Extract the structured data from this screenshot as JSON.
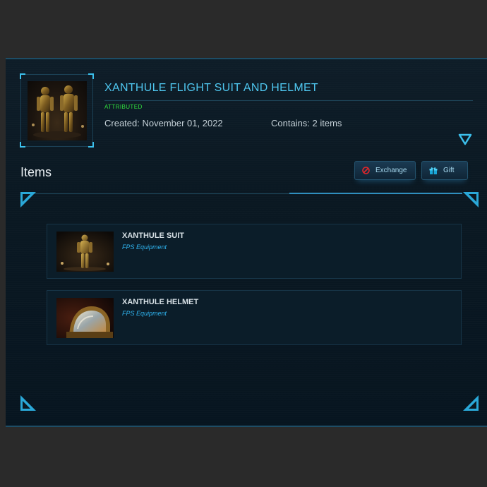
{
  "pledge": {
    "title": "XANTHULE FLIGHT SUIT AND HELMET",
    "status": "ATTRIBUTED",
    "created": "Created: November 01, 2022",
    "contains": "Contains: 2 items",
    "thumbnail": "xanthule-suit-pair-image"
  },
  "items_section": {
    "heading": "Items",
    "buttons": [
      {
        "label": "Exchange",
        "icon": "exchange-icon"
      },
      {
        "label": "Gift",
        "icon": "gift-icon"
      }
    ]
  },
  "items": [
    {
      "name": "XANTHULE SUIT",
      "type": "FPS Equipment",
      "image": "xanthule-suit-image"
    },
    {
      "name": "XANTHULE HELMET",
      "type": "FPS Equipment",
      "image": "xanthule-helmet-image"
    }
  ],
  "colors": {
    "accent": "#4fc7f0",
    "status": "#31e23e",
    "background": "#0a1822"
  }
}
